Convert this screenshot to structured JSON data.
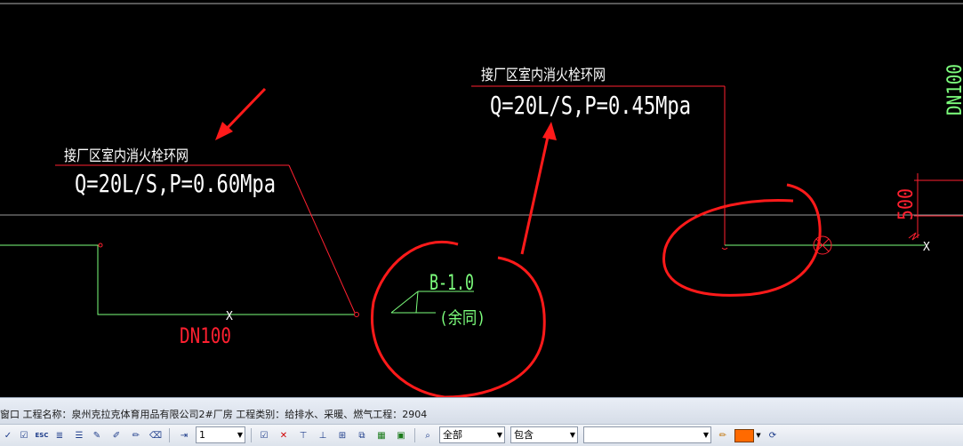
{
  "drawing": {
    "label_left_title": "接厂区室内消火栓环网",
    "label_left_value": "Q=20L/S,P=0.60Mpa",
    "label_right_title": "接厂区室内消火栓环网",
    "label_right_value": "Q=20L/S,P=0.45Mpa",
    "pipe_size_bottom": "DN100",
    "pipe_size_right": "DN100",
    "valve_tag": "B-1.0",
    "valve_note": "(余同)",
    "dim_500": "500",
    "x_mark": "X"
  },
  "status": {
    "text": "窗口 工程名称：泉州克拉克体育用品有限公司2#厂房 工程类别：给排水、采暖、燃气工程：2904"
  },
  "toolbar": {
    "layer_value": "1",
    "scope_value": "全部",
    "match_value": "包含",
    "search_value": "",
    "color_value": "#ff6a00",
    "icons": [
      "check-icon",
      "check-icon",
      "esc-icon",
      "list-check-icon",
      "list-icon",
      "edit-icon",
      "brush-icon",
      "pen-icon",
      "eraser-icon",
      "indent-icon",
      "checkbox-icon",
      "delete-icon",
      "filter-icon",
      "ruler-icon",
      "measure-icon",
      "layers-icon",
      "table-icon",
      "export-icon",
      "binoculars-icon",
      "pencil-icon",
      "color-swatch-icon",
      "refresh-icon"
    ]
  },
  "colors": {
    "background": "#000000",
    "cad_white": "#ffffff",
    "cad_red": "#ff2030",
    "cad_green": "#7dff7d",
    "annotation_red": "#ff1a1a"
  }
}
